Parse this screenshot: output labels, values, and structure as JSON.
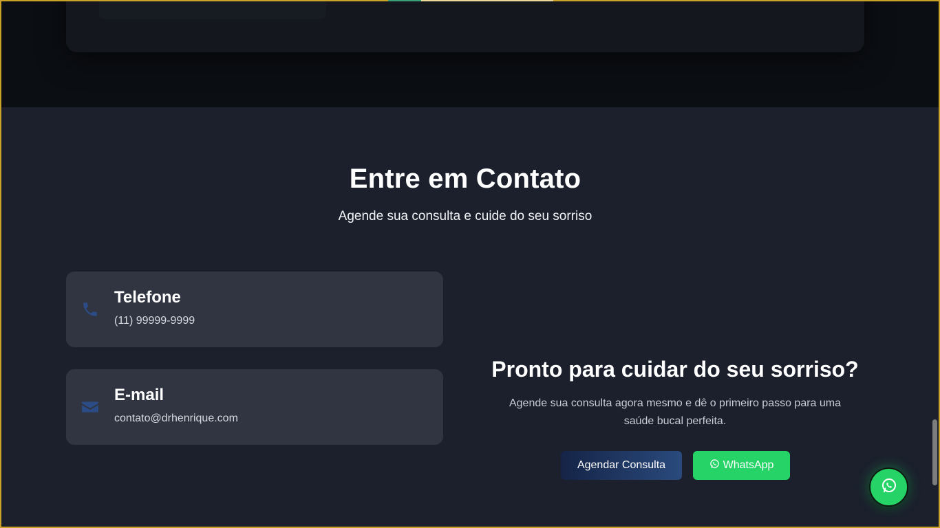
{
  "contact": {
    "title": "Entre em Contato",
    "subtitle": "Agende sua consulta e cuide do seu sorriso",
    "items": [
      {
        "label": "Telefone",
        "value": "(11) 99999-9999",
        "icon": "phone-icon"
      },
      {
        "label": "E-mail",
        "value": "contato@drhenrique.com",
        "icon": "envelope-icon"
      }
    ]
  },
  "cta": {
    "title": "Pronto para cuidar do seu sorriso?",
    "text": "Agende sua consulta agora mesmo e dê o primeiro passo para uma saúde bucal perfeita.",
    "schedule_label": "Agendar Consulta",
    "whatsapp_label": "WhatsApp"
  },
  "floating": {
    "icon": "whatsapp-icon"
  },
  "colors": {
    "page_bg": "#1b202c",
    "card_bg": "#313541",
    "icon_blue": "#2b4c86",
    "whatsapp_green": "#25d366",
    "schedule_gradient_start": "#152447",
    "schedule_gradient_end": "#2a4a7d"
  }
}
